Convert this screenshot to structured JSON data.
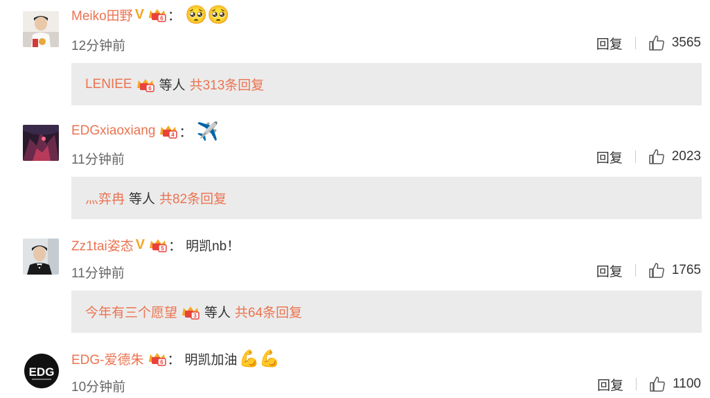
{
  "comments": [
    {
      "username": "Meiko田野",
      "verified": true,
      "text": "",
      "emoji": "🥺🥺",
      "time": "12分钟前",
      "reply_label": "回复",
      "likes": "3565",
      "reply_preview": {
        "user": "LENIEE",
        "mid": "等人",
        "total": "共313条回复"
      }
    },
    {
      "username": "EDGxiaoxiang",
      "verified": false,
      "text": "",
      "emoji": "✈️",
      "time": "11分钟前",
      "reply_label": "回复",
      "likes": "2023",
      "reply_preview": {
        "user": "灬弈冉",
        "mid": "等人",
        "total": "共82条回复"
      }
    },
    {
      "username": "Zz1tai姿态",
      "verified": true,
      "text": "明凯nb！",
      "emoji": "",
      "time": "11分钟前",
      "reply_label": "回复",
      "likes": "1765",
      "reply_preview": {
        "user": "今年有三个愿望",
        "mid": "等人",
        "total": "共64条回复"
      }
    },
    {
      "username": "EDG-爱德朱",
      "verified": false,
      "text": "明凯加油",
      "emoji": "💪💪",
      "time": "10分钟前",
      "reply_label": "回复",
      "likes": "1100"
    }
  ],
  "colon": "：",
  "avatar_text_edg": "EDG",
  "colors": {
    "accent": "#eb7350",
    "badge": "#f5a623",
    "reply_bg": "#ebebeb"
  }
}
